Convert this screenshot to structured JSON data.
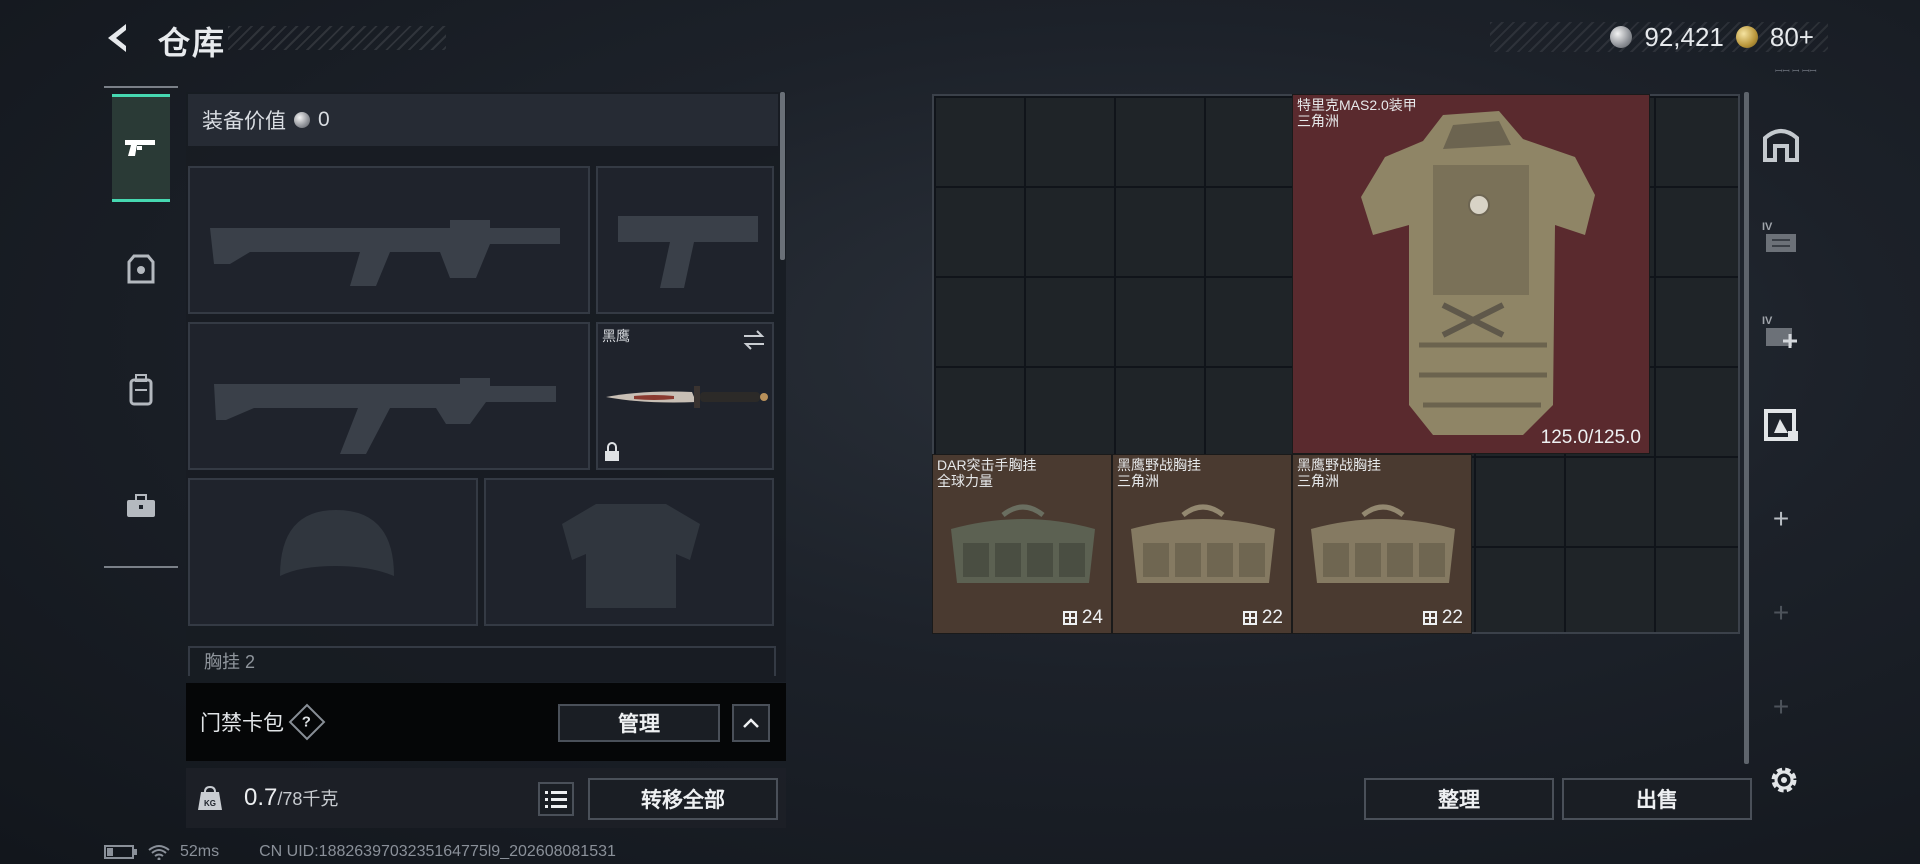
{
  "header": {
    "title": "仓库",
    "silver": "92,421",
    "gold": "80+",
    "tiny": "ꟷꟷ ꟷ ꟷꟷ"
  },
  "tabs": [
    {
      "name": "weapons",
      "icon": "pistol-icon",
      "active": true
    },
    {
      "name": "gear",
      "icon": "armor-vest-icon",
      "active": false
    },
    {
      "name": "backpack",
      "icon": "backpack-icon",
      "active": false
    },
    {
      "name": "kit",
      "icon": "briefcase-icon",
      "active": false
    }
  ],
  "equipment": {
    "value_label": "装备价值",
    "value": "0",
    "melee_name": "黑鹰",
    "chest_label": "胸挂 2"
  },
  "keycard": {
    "label": "门禁卡包",
    "help": "?",
    "manage": "管理"
  },
  "weight": {
    "current": "0.7",
    "max": "/78千克",
    "transfer_all": "转移全部"
  },
  "status": {
    "ping": "52ms",
    "uid": "CN UID:1882639703235164775l9_202608081531"
  },
  "stash": {
    "armor": {
      "name_line1": "特里克MAS2.0装甲",
      "name_line2": "三角洲",
      "durability": "125.0/125.0"
    },
    "rigs": [
      {
        "line1": "DAR突击手胸挂",
        "line2": "全球力量",
        "capacity": "24"
      },
      {
        "line1": "黑鹰野战胸挂",
        "line2": "三角洲",
        "capacity": "22"
      },
      {
        "line1": "黑鹰野战胸挂",
        "line2": "三角洲",
        "capacity": "22"
      }
    ],
    "sort": "整理",
    "sell": "出售"
  },
  "colors": {
    "accent": "#46d8b1",
    "armor_bg": "#5a2a2e",
    "rig_bg": "#4a3a30"
  }
}
